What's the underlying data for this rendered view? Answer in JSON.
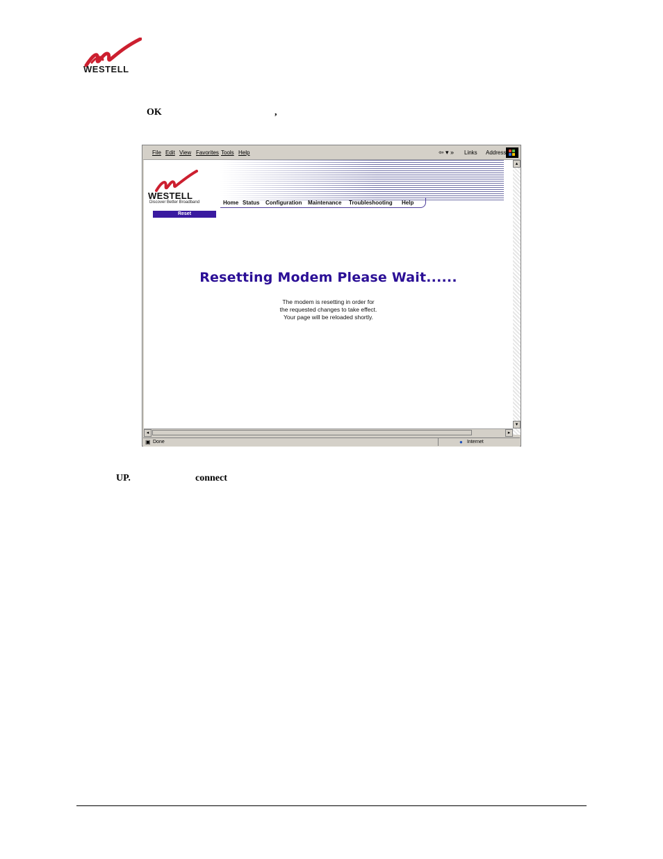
{
  "document": {
    "logo_text": "WESTELL",
    "step_text_1": "OK",
    "step_text_2": ",",
    "step_text_3": "UP.",
    "step_text_4": "connect"
  },
  "browser": {
    "menu": [
      "File",
      "Edit",
      "View",
      "Favorites",
      "Tools",
      "Help"
    ],
    "links_label": "Links",
    "address_label": "Address",
    "status_text": "Done",
    "zone_text": "Internet"
  },
  "page": {
    "logo_text": "WESTELL",
    "tagline": "Discover  Better  Broadband",
    "nav": [
      "Home",
      "Status",
      "Configuration",
      "Maintenance",
      "Troubleshooting",
      "Help"
    ],
    "section_label": "Reset",
    "headline": "Resetting Modem Please Wait......",
    "message_lines": [
      "The modem is resetting in order for",
      "the requested changes to take effect.",
      "Your page will be reloaded shortly."
    ]
  },
  "colors": {
    "brand_red": "#cc1f2f",
    "accent_purple": "#2b0f96"
  },
  "icons": [
    "westell-logo-icon",
    "back-arrow-icon",
    "windows-logo-icon",
    "globe-icon",
    "scroll-up-icon",
    "scroll-down-icon",
    "scroll-left-icon",
    "scroll-right-icon"
  ]
}
